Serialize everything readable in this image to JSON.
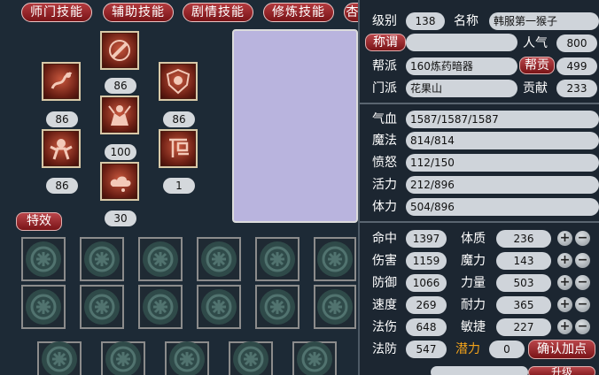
{
  "tabs": [
    "师门技能",
    "辅助技能",
    "剧情技能",
    "修炼技能",
    "杏"
  ],
  "skills": [
    {
      "icon": "dragon-skill-icon",
      "level": "86"
    },
    {
      "icon": "staff-skill-icon",
      "level": "86"
    },
    {
      "icon": "shield-skill-icon",
      "level": "86"
    },
    {
      "icon": "monk-skill-icon",
      "level": "100"
    },
    {
      "icon": "monkey-skill-icon",
      "level": "86"
    },
    {
      "icon": "rune-skill-icon",
      "level": "1"
    },
    {
      "icon": "cloud-skill-icon",
      "level": "30"
    }
  ],
  "special_label": "特效",
  "character": {
    "level_label": "级别",
    "level": "138",
    "name_label": "名称",
    "name": "韩服第一猴子",
    "title_label": "称谓",
    "title": "",
    "popularity_label": "人气",
    "popularity": "800",
    "gang_label": "帮派",
    "gang": "160炼药暗器",
    "gang_contrib_label": "帮贡",
    "gang_contrib": "499",
    "sect_label": "门派",
    "sect": "花果山",
    "contrib_label": "贡献",
    "contrib": "233"
  },
  "vitals": [
    {
      "label": "气血",
      "value": "1587/1587/1587"
    },
    {
      "label": "魔法",
      "value": "814/814"
    },
    {
      "label": "愤怒",
      "value": "112/150"
    },
    {
      "label": "活力",
      "value": "212/896"
    },
    {
      "label": "体力",
      "value": "504/896"
    }
  ],
  "attributes": {
    "left": [
      {
        "label": "命中",
        "value": "1397"
      },
      {
        "label": "伤害",
        "value": "1159"
      },
      {
        "label": "防御",
        "value": "1066"
      },
      {
        "label": "速度",
        "value": "269"
      },
      {
        "label": "法伤",
        "value": "648"
      },
      {
        "label": "法防",
        "value": "547"
      }
    ],
    "right": [
      {
        "label": "体质",
        "value": "236"
      },
      {
        "label": "魔力",
        "value": "143"
      },
      {
        "label": "力量",
        "value": "503"
      },
      {
        "label": "耐力",
        "value": "365"
      },
      {
        "label": "敏捷",
        "value": "227"
      }
    ],
    "potential_label": "潜力",
    "potential": "0",
    "confirm_label": "确认加点",
    "upgrade_label": "升级",
    "plus": "+",
    "minus": "−"
  },
  "colors": {
    "tab": "#9b2328",
    "field": "#cfd4da",
    "potential": "#f2a21a"
  }
}
